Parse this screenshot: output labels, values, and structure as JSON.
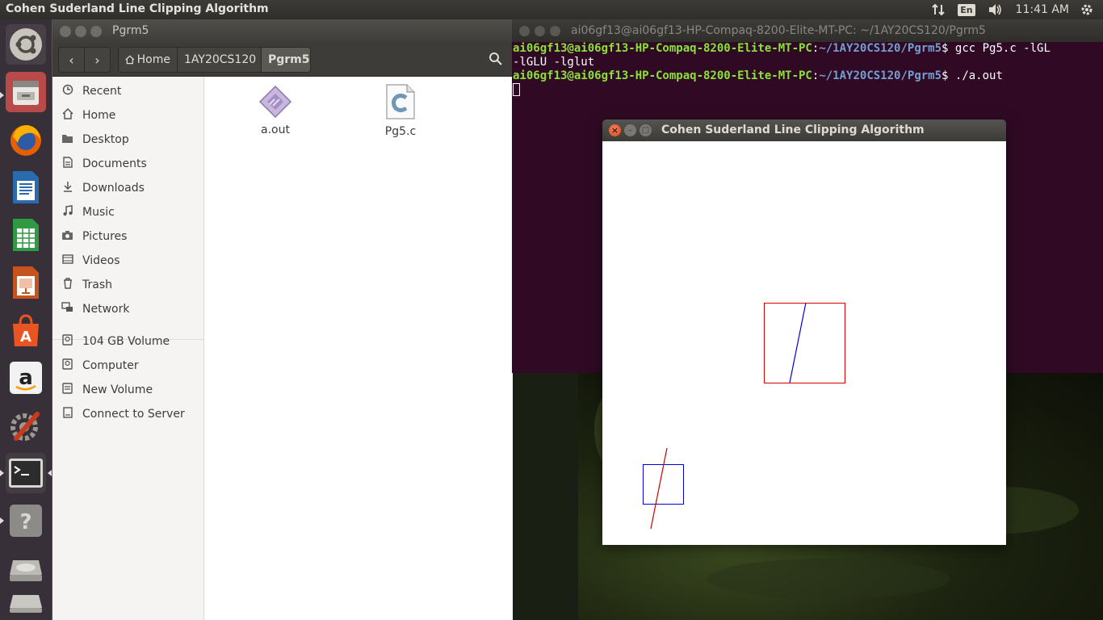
{
  "top_panel": {
    "app_title": "Cohen Suderland Line Clipping Algorithm",
    "keyboard_layout": "En",
    "time": "11:41 AM"
  },
  "launcher": {
    "items": [
      "dash-home",
      "files",
      "firefox",
      "libreoffice-writer",
      "libreoffice-calc",
      "libreoffice-impress",
      "ubuntu-software",
      "amazon",
      "system-settings",
      "terminal",
      "help",
      "disks",
      "trash"
    ]
  },
  "file_manager": {
    "title": "Pgrm5",
    "breadcrumbs": [
      "Home",
      "1AY20CS120",
      "Pgrm5"
    ],
    "sidebar": [
      {
        "icon": "clock-icon",
        "label": "Recent"
      },
      {
        "icon": "home-icon",
        "label": "Home"
      },
      {
        "icon": "folder-icon",
        "label": "Desktop"
      },
      {
        "icon": "document-icon",
        "label": "Documents"
      },
      {
        "icon": "download-icon",
        "label": "Downloads"
      },
      {
        "icon": "music-icon",
        "label": "Music"
      },
      {
        "icon": "camera-icon",
        "label": "Pictures"
      },
      {
        "icon": "video-icon",
        "label": "Videos"
      },
      {
        "icon": "trash-icon",
        "label": "Trash"
      },
      {
        "icon": "network-icon",
        "label": "Network"
      },
      {
        "icon": "drive-icon",
        "label": "104 GB Volume"
      },
      {
        "icon": "drive-icon",
        "label": "Computer"
      },
      {
        "icon": "drive-icon",
        "label": "New Volume"
      },
      {
        "icon": "server-icon",
        "label": "Connect to Server"
      }
    ],
    "files": [
      {
        "name": "a.out",
        "icon": "executable-icon"
      },
      {
        "name": "Pg5.c",
        "icon": "c-source-icon"
      }
    ]
  },
  "terminal": {
    "title": "ai06gf13@ai06gf13-HP-Compaq-8200-Elite-MT-PC: ~/1AY20CS120/Pgrm5",
    "lines": [
      {
        "user": "ai06gf13@ai06gf13-HP-Compaq-8200-Elite-MT-PC",
        "path": "~/1AY20CS120/Pgrm5",
        "cmd": "$ gcc Pg5.c -lGL"
      },
      {
        "text": "-lGLU -lglut"
      },
      {
        "user": "ai06gf13@ai06gf13-HP-Compaq-8200-Elite-MT-PC",
        "path": "~/1AY20CS120/Pgrm5",
        "cmd": "$ ./a.out"
      }
    ]
  },
  "glut_window": {
    "title": "Cohen Suderland Line Clipping Algorithm",
    "colors": {
      "clip_window": "#dd0000",
      "clipped_line": "#0000dd",
      "original_window": "#0000cc",
      "original_line": "#cc0000"
    }
  }
}
